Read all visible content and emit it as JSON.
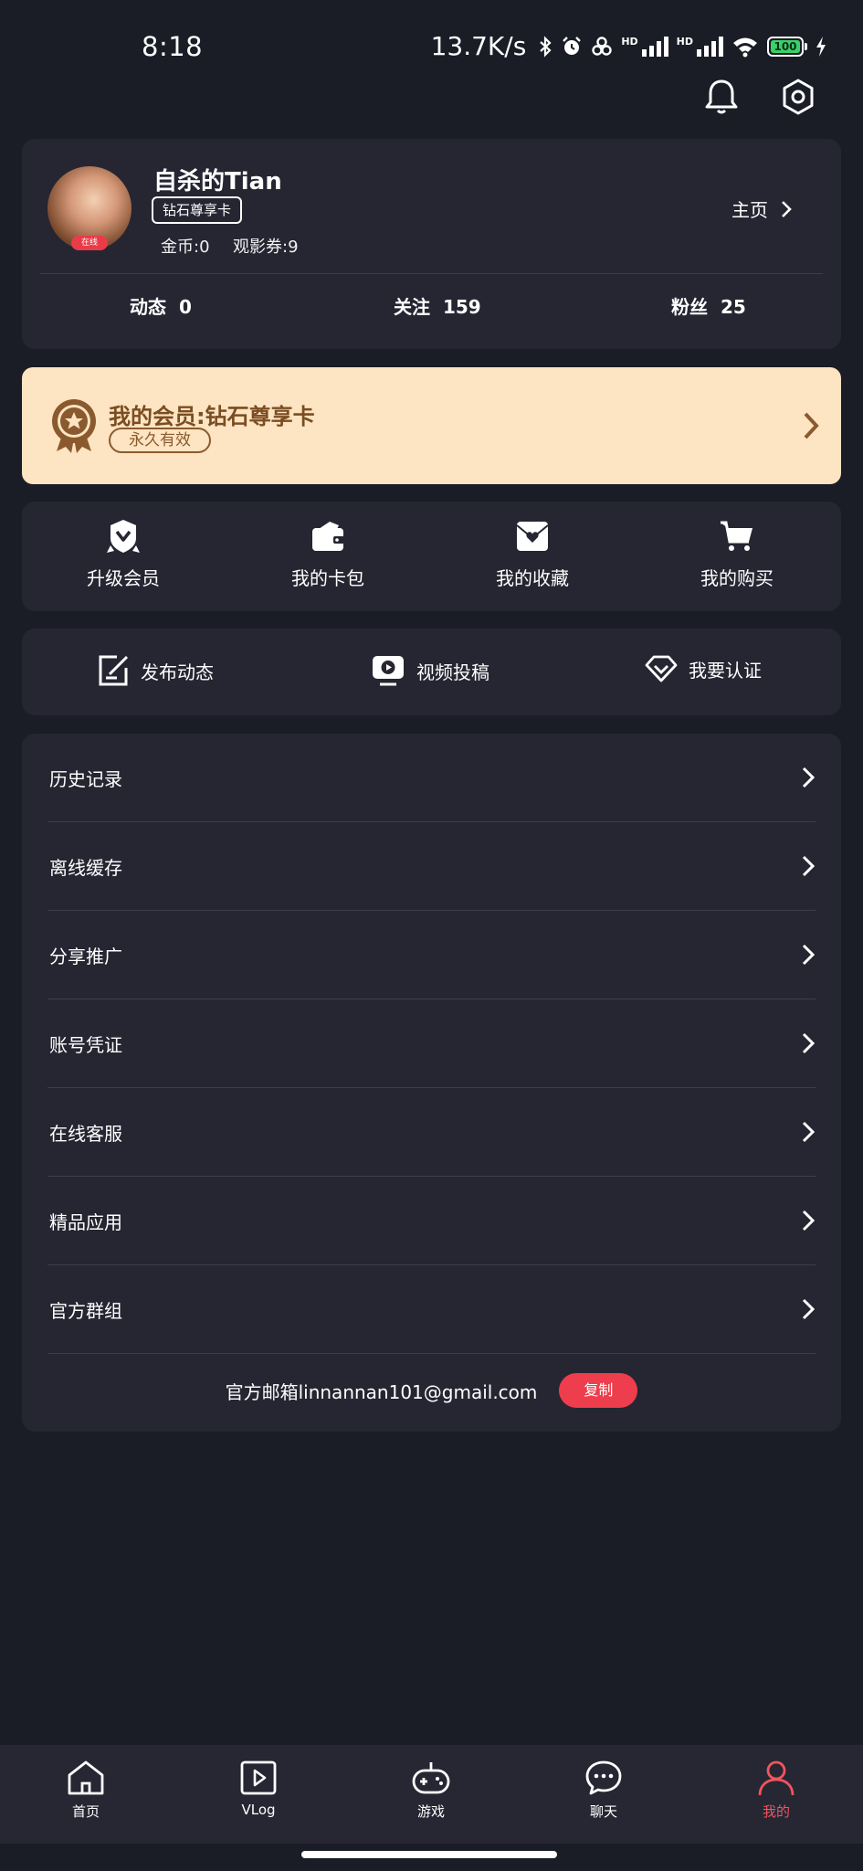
{
  "status_bar": {
    "time": "8:18",
    "network_speed": "13.7K/s",
    "battery": "100",
    "icons": [
      "bluetooth-icon",
      "alarm-icon",
      "link-icon",
      "signal-icon",
      "signal-icon",
      "wifi-icon",
      "battery-icon",
      "charging-icon"
    ]
  },
  "header": {
    "icons": [
      "bell-icon",
      "settings-icon"
    ]
  },
  "profile": {
    "username": "自杀的Tian",
    "vip_tag": "钻石尊享卡",
    "online_badge": "在线",
    "coins": "金币:0",
    "tickets": "观影券:9",
    "homepage_label": "主页",
    "stats": [
      {
        "label": "动态",
        "value": "0"
      },
      {
        "label": "关注",
        "value": "159"
      },
      {
        "label": "粉丝",
        "value": "25"
      }
    ]
  },
  "membership": {
    "title": "我的会员:钻石尊享卡",
    "validity": "永久有效",
    "icon": "medal-icon"
  },
  "quick_grid": [
    {
      "label": "升级会员",
      "icon": "vip-upgrade-icon"
    },
    {
      "label": "我的卡包",
      "icon": "wallet-icon"
    },
    {
      "label": "我的收藏",
      "icon": "favorites-icon"
    },
    {
      "label": "我的购买",
      "icon": "cart-icon"
    }
  ],
  "actions": [
    {
      "label": "发布动态",
      "icon": "edit-icon"
    },
    {
      "label": "视频投稿",
      "icon": "video-upload-icon"
    },
    {
      "label": "我要认证",
      "icon": "diamond-icon"
    }
  ],
  "menu": [
    {
      "label": "历史记录"
    },
    {
      "label": "离线缓存"
    },
    {
      "label": "分享推广"
    },
    {
      "label": "账号凭证"
    },
    {
      "label": "在线客服"
    },
    {
      "label": "精品应用"
    },
    {
      "label": "官方群组"
    }
  ],
  "email": {
    "text": "官方邮箱linnannan101@gmail.com",
    "copy_label": "复制"
  },
  "bottom_nav": [
    {
      "label": "首页",
      "icon": "home-icon"
    },
    {
      "label": "VLog",
      "icon": "play-icon"
    },
    {
      "label": "游戏",
      "icon": "gamepad-icon"
    },
    {
      "label": "聊天",
      "icon": "chat-icon"
    },
    {
      "label": "我的",
      "icon": "user-icon",
      "active": true
    }
  ],
  "colors": {
    "background": "#1a1c26",
    "card": "#252632",
    "member_bg": "#fde4c2",
    "member_text": "#7a4d22",
    "accent": "#ee3d4c"
  }
}
